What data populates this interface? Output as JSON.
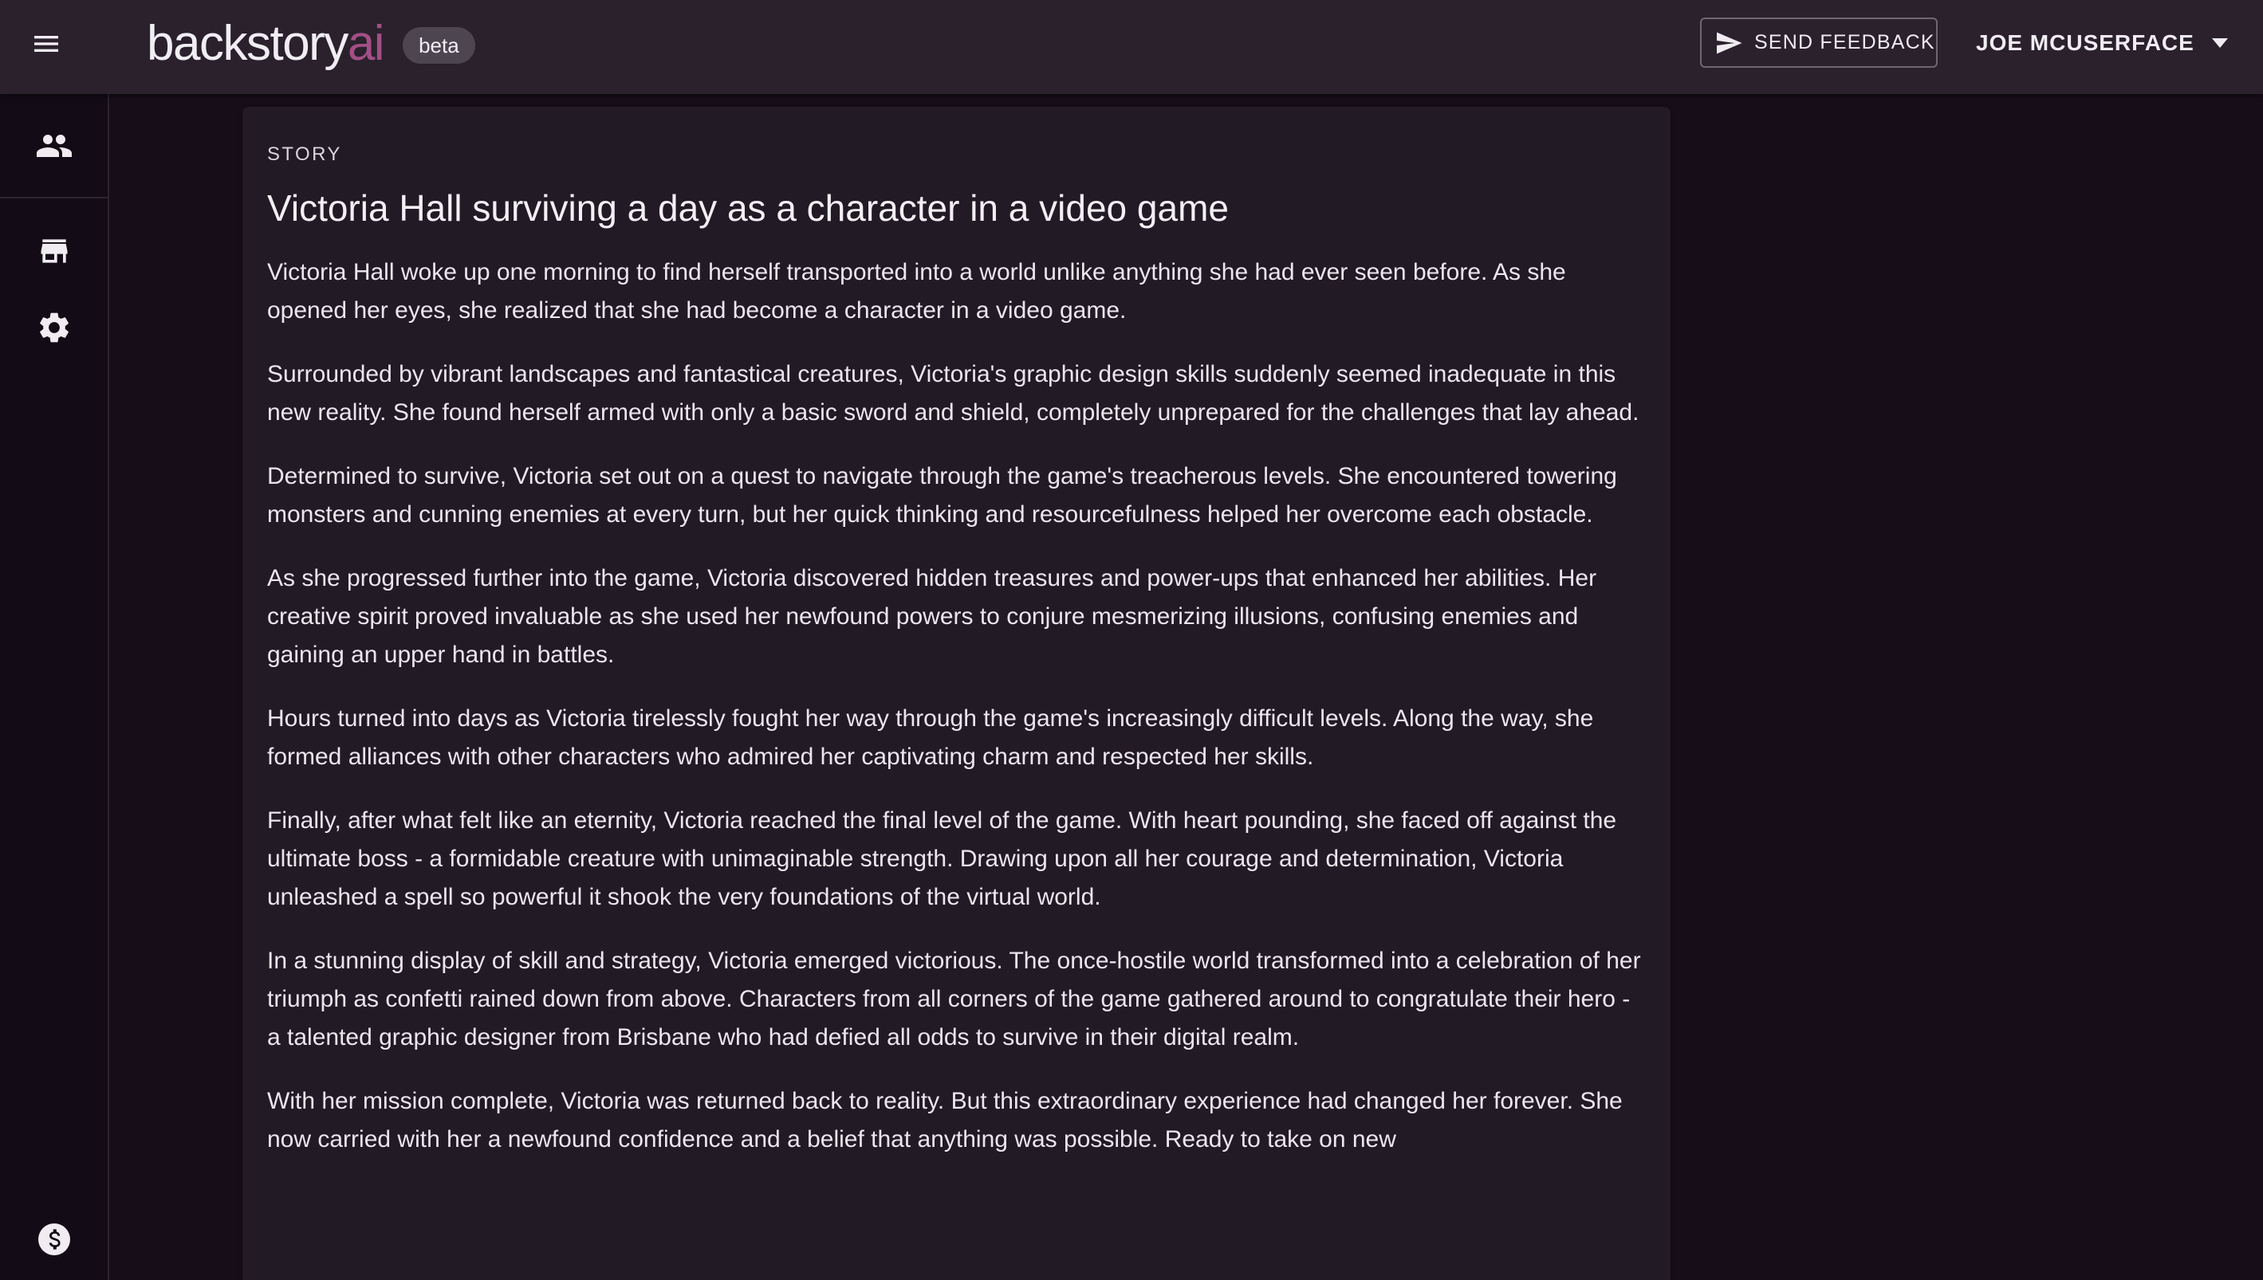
{
  "header": {
    "brand_main": "backstory",
    "brand_accent": "ai",
    "badge": "beta",
    "feedback_label": "SEND FEEDBACK",
    "user_name": "JOE MCUSERFACE"
  },
  "sidebar": {
    "items": [
      {
        "name": "people",
        "icon": "people-icon"
      },
      {
        "name": "store",
        "icon": "store-icon"
      },
      {
        "name": "settings",
        "icon": "gear-icon"
      },
      {
        "name": "billing",
        "icon": "dollar-icon"
      }
    ]
  },
  "story": {
    "eyebrow": "STORY",
    "title": "Victoria Hall surviving a day as a character in a video game",
    "paragraphs": [
      "Victoria Hall woke up one morning to find herself transported into a world unlike anything she had ever seen before. As she opened her eyes, she realized that she had become a character in a video game.",
      "Surrounded by vibrant landscapes and fantastical creatures, Victoria's graphic design skills suddenly seemed inadequate in this new reality. She found herself armed with only a basic sword and shield, completely unprepared for the challenges that lay ahead.",
      "Determined to survive, Victoria set out on a quest to navigate through the game's treacherous levels. She encountered towering monsters and cunning enemies at every turn, but her quick thinking and resourcefulness helped her overcome each obstacle.",
      "As she progressed further into the game, Victoria discovered hidden treasures and power-ups that enhanced her abilities. Her creative spirit proved invaluable as she used her newfound powers to conjure mesmerizing illusions, confusing enemies and gaining an upper hand in battles.",
      "Hours turned into days as Victoria tirelessly fought her way through the game's increasingly difficult levels. Along the way, she formed alliances with other characters who admired her captivating charm and respected her skills.",
      "Finally, after what felt like an eternity, Victoria reached the final level of the game. With heart pounding, she faced off against the ultimate boss - a formidable creature with unimaginable strength. Drawing upon all her courage and determination, Victoria unleashed a spell so powerful it shook the very foundations of the virtual world.",
      "In a stunning display of skill and strategy, Victoria emerged victorious. The once-hostile world transformed into a celebration of her triumph as confetti rained down from above. Characters from all corners of the game gathered around to congratulate their hero - a talented graphic designer from Brisbane who had defied all odds to survive in their digital realm.",
      "With her mission complete, Victoria was returned back to reality. But this extraordinary experience had changed her forever. She now carried with her a newfound confidence and a belief that anything was possible. Ready to take on new"
    ]
  },
  "colors": {
    "background": "#160d18",
    "topbar": "#2a212d",
    "card": "#221a25",
    "brand_accent": "#a24f86",
    "text": "#ece8ee"
  }
}
